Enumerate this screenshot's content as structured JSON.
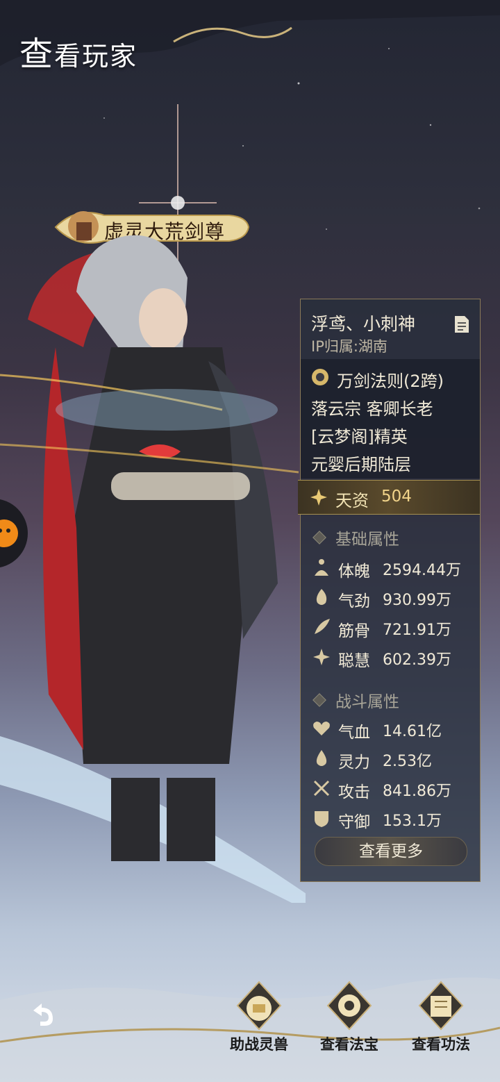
{
  "header": {
    "title_big": "查",
    "title_rest": "看玩家"
  },
  "badge": {
    "title": "虚灵大荒剑尊"
  },
  "player": {
    "name": "浮鸢、小刺神",
    "ip": "IP归属:湖南",
    "lines": [
      "万剑法则(2跨)",
      "落云宗 客卿长老",
      "[云梦阁]精英",
      "元婴后期陆层"
    ],
    "talent_label": "天资",
    "talent_value": "504"
  },
  "basic": {
    "title": "基础属性",
    "stats": [
      {
        "label": "体魄",
        "value": "2594.44万",
        "icon": "meditate-icon"
      },
      {
        "label": "气劲",
        "value": "930.99万",
        "icon": "flame-icon"
      },
      {
        "label": "筋骨",
        "value": "721.91万",
        "icon": "feather-icon"
      },
      {
        "label": "聪慧",
        "value": "602.39万",
        "icon": "sparkle-icon"
      }
    ]
  },
  "combat": {
    "title": "战斗属性",
    "stats": [
      {
        "label": "气血",
        "value": "14.61亿",
        "icon": "heart-icon"
      },
      {
        "label": "灵力",
        "value": "2.53亿",
        "icon": "spirit-drop-icon"
      },
      {
        "label": "攻击",
        "value": "841.86万",
        "icon": "crossed-swords-icon"
      },
      {
        "label": "守御",
        "value": "153.1万",
        "icon": "shield-icon"
      }
    ]
  },
  "more_button": "查看更多",
  "bottom": {
    "buttons": [
      {
        "label": "助战灵兽",
        "icon": "beast-pouch-icon"
      },
      {
        "label": "查看法宝",
        "icon": "treasure-icon"
      },
      {
        "label": "查看功法",
        "icon": "scroll-book-icon"
      }
    ]
  },
  "colors": {
    "panel_bg": "#282e3c",
    "gold": "#d8b86a",
    "accent_red": "#c8292b"
  }
}
